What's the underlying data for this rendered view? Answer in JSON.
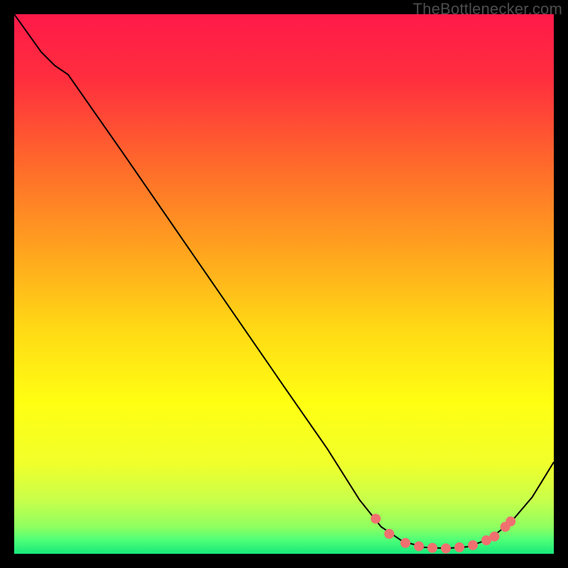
{
  "watermark": "TheBottlenecker.com",
  "chart_data": {
    "type": "line",
    "title": "",
    "xlabel": "",
    "ylabel": "",
    "xlim": [
      0,
      100
    ],
    "ylim": [
      0,
      100
    ],
    "background_gradient": {
      "stops": [
        {
          "offset": 0.0,
          "color": "#ff1a49"
        },
        {
          "offset": 0.12,
          "color": "#ff2e3e"
        },
        {
          "offset": 0.28,
          "color": "#ff6a2b"
        },
        {
          "offset": 0.44,
          "color": "#ffa41e"
        },
        {
          "offset": 0.58,
          "color": "#ffd815"
        },
        {
          "offset": 0.72,
          "color": "#ffff12"
        },
        {
          "offset": 0.83,
          "color": "#f1ff2a"
        },
        {
          "offset": 0.9,
          "color": "#c9ff4a"
        },
        {
          "offset": 0.95,
          "color": "#8fff60"
        },
        {
          "offset": 0.975,
          "color": "#4dff78"
        },
        {
          "offset": 1.0,
          "color": "#17e87a"
        }
      ]
    },
    "curve": {
      "stroke": "#000000",
      "stroke_width": 2,
      "points": [
        {
          "x": 0.0,
          "y": 100.0
        },
        {
          "x": 5.0,
          "y": 93.0
        },
        {
          "x": 7.5,
          "y": 90.5
        },
        {
          "x": 10.0,
          "y": 88.8
        },
        {
          "x": 20.0,
          "y": 74.5
        },
        {
          "x": 30.0,
          "y": 60.0
        },
        {
          "x": 40.0,
          "y": 45.5
        },
        {
          "x": 50.0,
          "y": 31.0
        },
        {
          "x": 58.0,
          "y": 19.5
        },
        {
          "x": 64.0,
          "y": 10.0
        },
        {
          "x": 68.0,
          "y": 5.0
        },
        {
          "x": 72.0,
          "y": 2.3
        },
        {
          "x": 76.0,
          "y": 1.2
        },
        {
          "x": 80.0,
          "y": 1.0
        },
        {
          "x": 84.0,
          "y": 1.3
        },
        {
          "x": 88.0,
          "y": 2.7
        },
        {
          "x": 92.0,
          "y": 5.8
        },
        {
          "x": 96.0,
          "y": 10.5
        },
        {
          "x": 100.0,
          "y": 17.0
        }
      ]
    },
    "markers": {
      "fill": "#f07070",
      "radius": 7,
      "points": [
        {
          "x": 67.0,
          "y": 6.5
        },
        {
          "x": 69.5,
          "y": 3.7
        },
        {
          "x": 72.5,
          "y": 2.0
        },
        {
          "x": 75.0,
          "y": 1.4
        },
        {
          "x": 77.5,
          "y": 1.1
        },
        {
          "x": 80.0,
          "y": 1.0
        },
        {
          "x": 82.5,
          "y": 1.2
        },
        {
          "x": 85.0,
          "y": 1.6
        },
        {
          "x": 87.5,
          "y": 2.5
        },
        {
          "x": 89.0,
          "y": 3.2
        },
        {
          "x": 91.0,
          "y": 5.0
        },
        {
          "x": 92.0,
          "y": 6.0
        }
      ]
    }
  }
}
